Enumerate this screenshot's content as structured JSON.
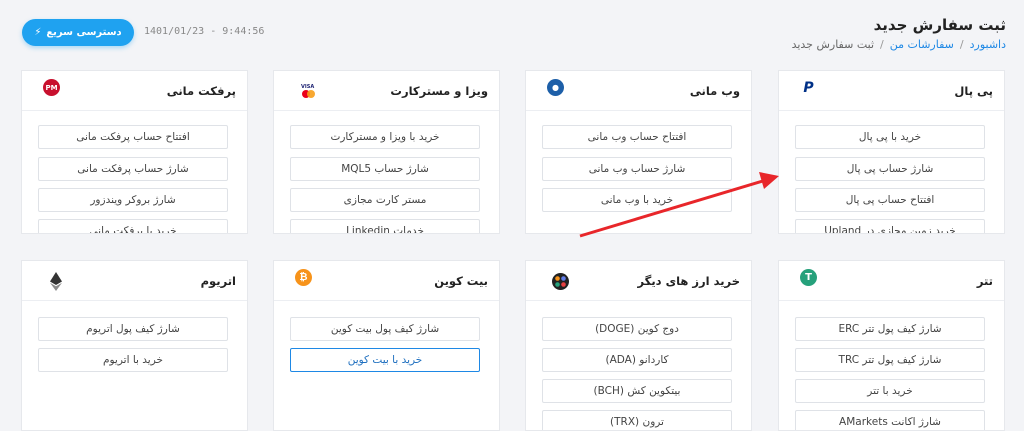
{
  "header": {
    "title": "ثبت سفارش جدید",
    "breadcrumb": [
      "داشبورد",
      "سفارشات من",
      "ثبت سفارش جدید"
    ],
    "quick_access_label": "دسترسی سریع",
    "timestamp": "1401/01/23 - 9:44:56"
  },
  "cards": [
    {
      "title": "پی پال",
      "icon": "paypal-icon",
      "items": [
        "خرید با پی پال",
        "شارژ حساب پی پال",
        "افتتاح حساب پی پال",
        "خرید زمین مجازی در Upland"
      ]
    },
    {
      "title": "وب مانی",
      "icon": "webmoney-icon",
      "items": [
        "افتتاح حساب وب مانی",
        "شارژ حساب وب مانی",
        "خرید با وب مانی"
      ]
    },
    {
      "title": "ویزا و مسترکارت",
      "icon": "visa-mastercard-icon",
      "items": [
        "خرید با ویزا و مسترکارت",
        "شارژ حساب MQL5",
        "مستر کارت مجازی",
        "خدمات Linkedin"
      ]
    },
    {
      "title": "پرفکت مانی",
      "icon": "perfect-money-icon",
      "items": [
        "افتتاح حساب پرفکت مانی",
        "شارژ حساب پرفکت مانی",
        "شارژ بروکر ویندزور",
        "خرید با پرفکت مانی"
      ]
    },
    {
      "title": "تتر",
      "icon": "tether-icon",
      "items": [
        "شارژ کیف پول تتر ERC",
        "شارژ کیف پول تتر TRC",
        "خرید با تتر",
        "شارژ اکانت AMarkets"
      ]
    },
    {
      "title": "خرید ارز های دیگر",
      "icon": "other-crypto-icon",
      "items": [
        "دوج کوین (DOGE)",
        "کاردانو (ADA)",
        "بیتکوین کش (BCH)",
        "ترون (TRX)"
      ]
    },
    {
      "title": "بیت کوین",
      "icon": "bitcoin-icon",
      "items": [
        "شارژ کیف پول بیت کوین",
        "خرید با بیت کوین"
      ]
    },
    {
      "title": "اتریوم",
      "icon": "ethereum-icon",
      "items": [
        "شارژ کیف پول اتریوم",
        "خرید با اتریوم"
      ]
    }
  ],
  "colors": {
    "accent": "#1fa2f0",
    "arrow": "#e8262a",
    "background": "#f3f4f7"
  }
}
